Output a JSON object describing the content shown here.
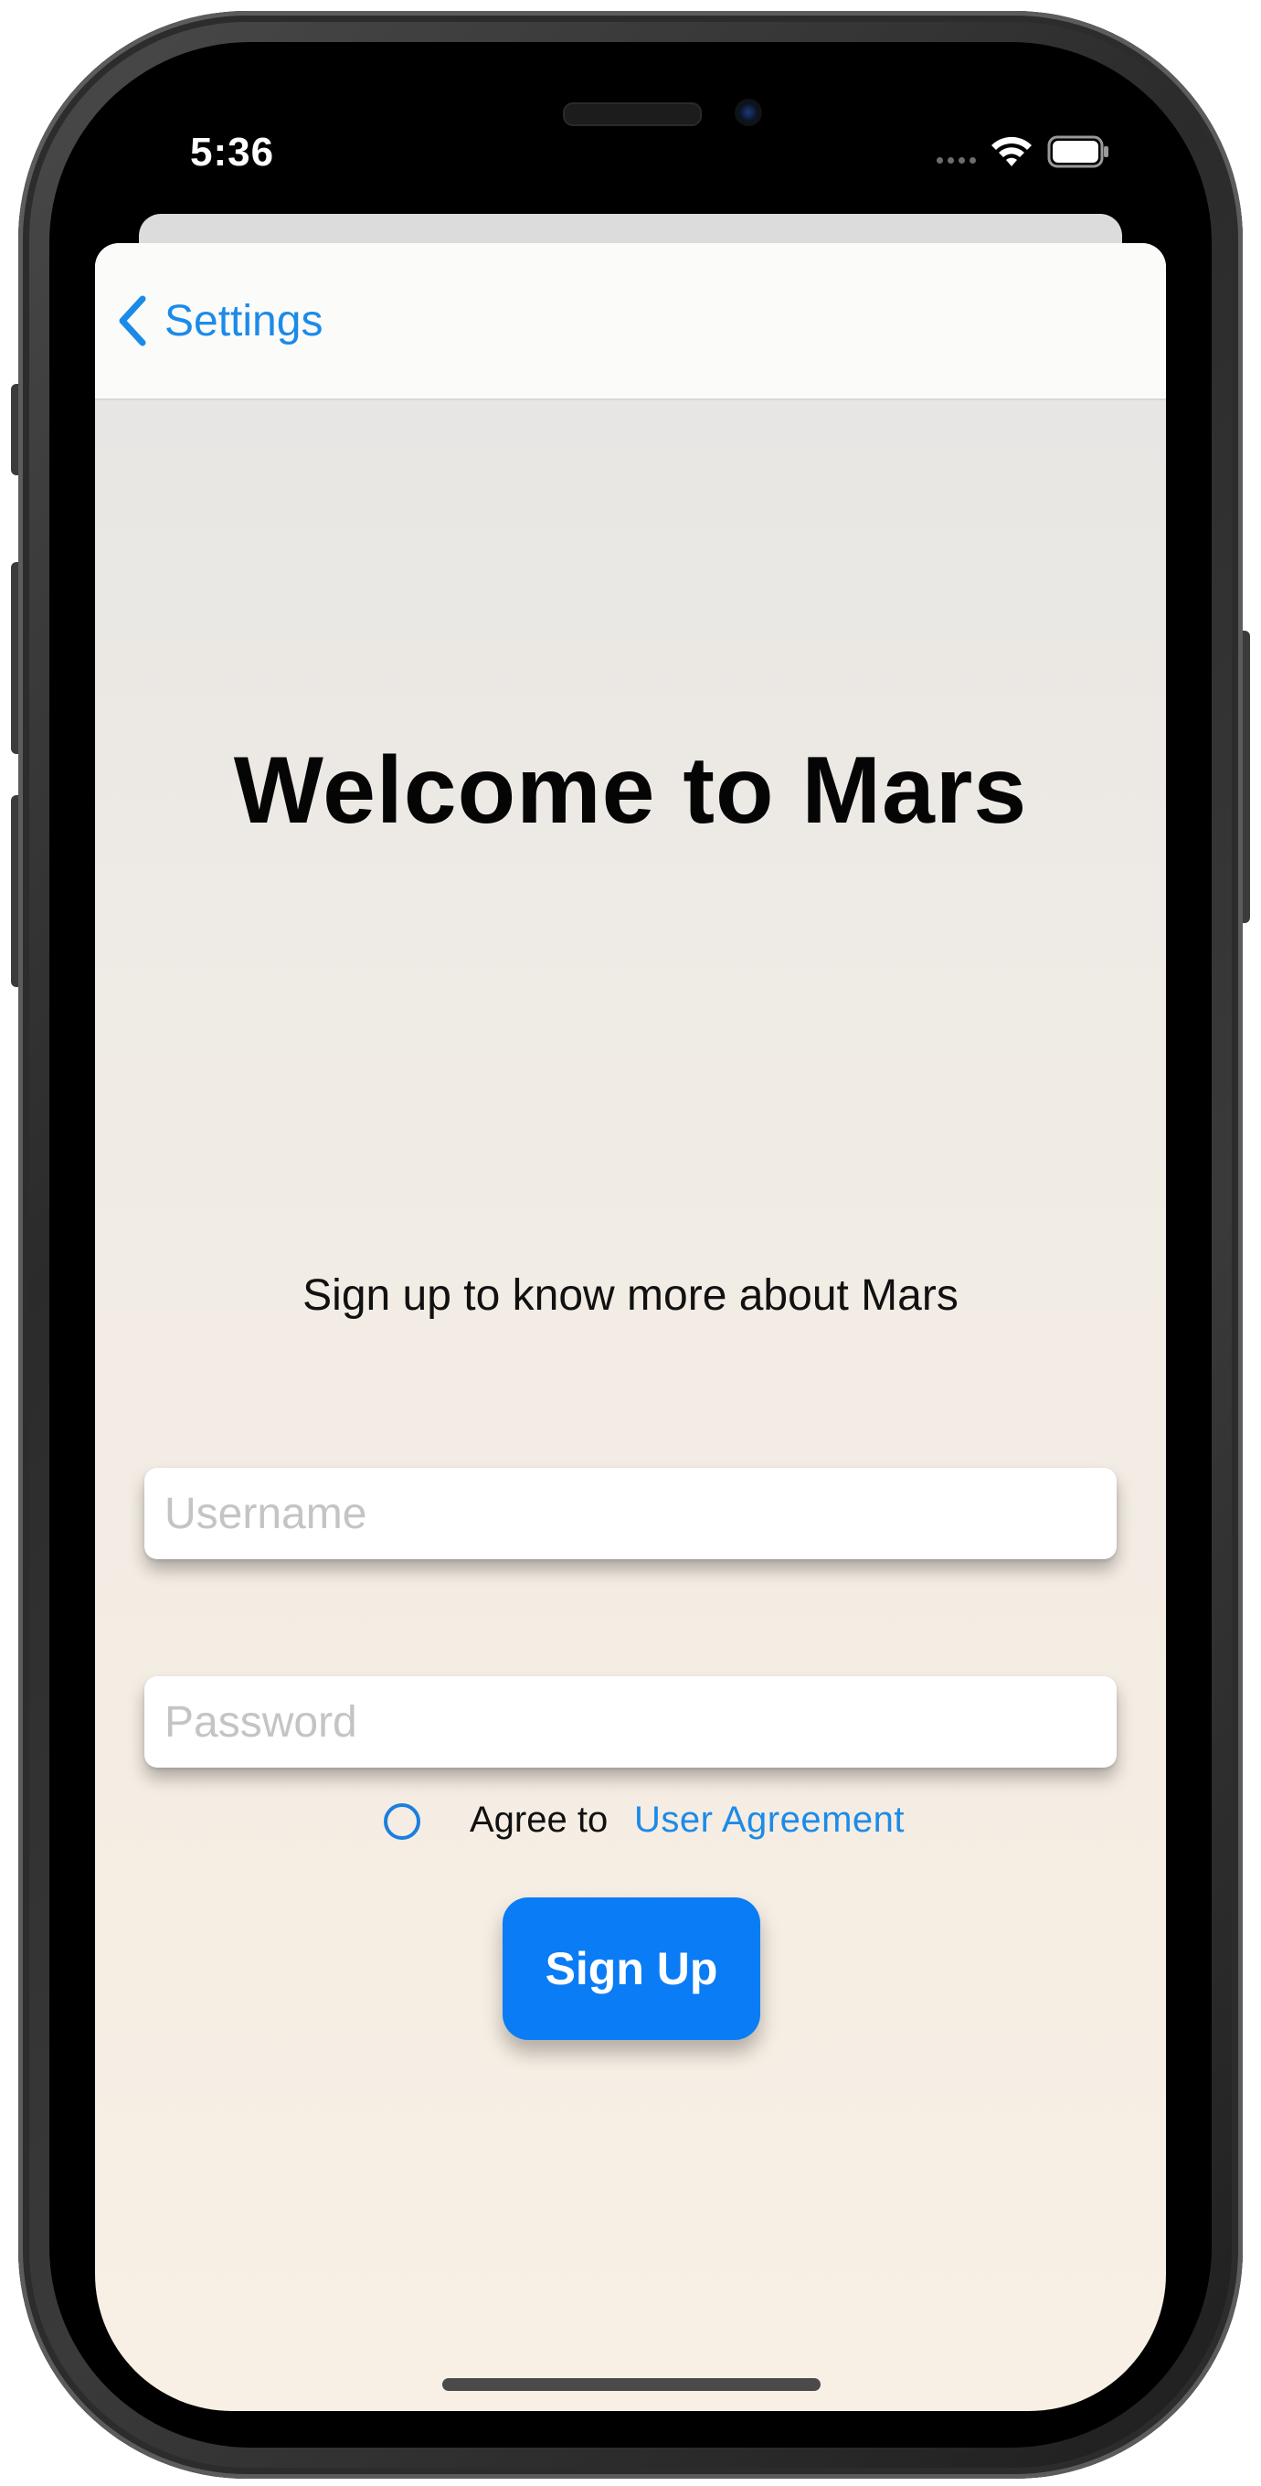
{
  "status_bar": {
    "time": "5:36",
    "icons": [
      "cellular-icon",
      "wifi-icon",
      "battery-icon"
    ]
  },
  "nav": {
    "back_label": "Settings",
    "back_icon": "chevron-left-icon"
  },
  "main": {
    "title": "Welcome to Mars",
    "subtitle": "Sign up to know more about Mars",
    "username_placeholder": "Username",
    "password_placeholder": "Password",
    "agree_text": "Agree to",
    "agreement_link": "User Agreement",
    "agree_checked": false,
    "signup_label": "Sign Up"
  },
  "colors": {
    "accent": "#0a7cf5",
    "link": "#1c8be8",
    "background_top": "#e6e5e4",
    "background_bottom": "#f8f0e4"
  }
}
